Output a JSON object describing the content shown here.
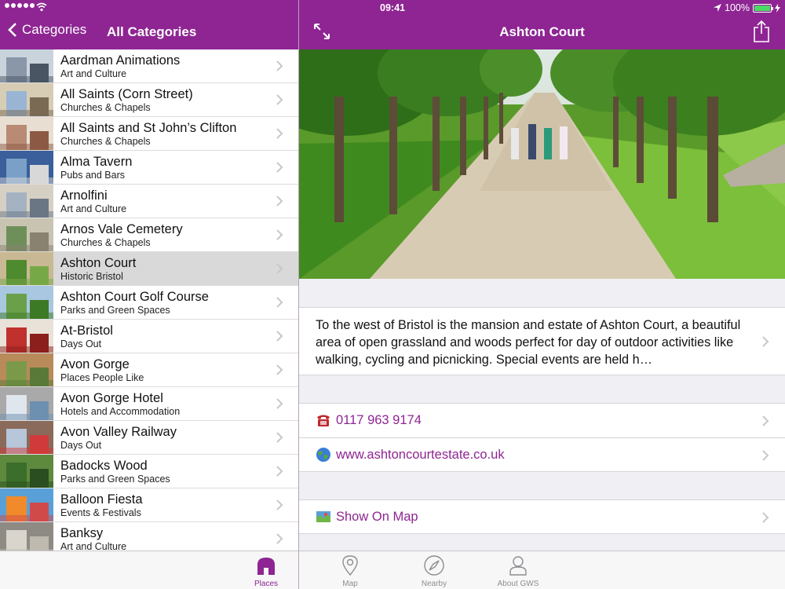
{
  "status": {
    "time": "09:41",
    "battery": "100%",
    "battery_level": 1.0
  },
  "colors": {
    "brand": "#8e2593",
    "selected_row": "#d9d9d9",
    "link": "#8e2593"
  },
  "left_nav": {
    "back_label": "Categories",
    "title": "All Categories"
  },
  "right_nav": {
    "title": "Ashton Court"
  },
  "places": [
    {
      "title": "Aardman Animations",
      "category": "Art and Culture"
    },
    {
      "title": "All Saints (Corn Street)",
      "category": "Churches & Chapels"
    },
    {
      "title": "All Saints and St John’s Clifton",
      "category": "Churches & Chapels"
    },
    {
      "title": "Alma Tavern",
      "category": "Pubs and Bars"
    },
    {
      "title": "Arnolfini",
      "category": "Art and Culture"
    },
    {
      "title": "Arnos Vale Cemetery",
      "category": "Churches & Chapels"
    },
    {
      "title": "Ashton Court",
      "category": "Historic Bristol",
      "selected": true
    },
    {
      "title": "Ashton Court Golf Course",
      "category": "Parks and Green Spaces"
    },
    {
      "title": "At-Bristol",
      "category": "Days Out"
    },
    {
      "title": "Avon Gorge",
      "category": "Places People Like"
    },
    {
      "title": "Avon Gorge Hotel",
      "category": "Hotels and Accommodation"
    },
    {
      "title": "Avon Valley Railway",
      "category": "Days Out"
    },
    {
      "title": "Badocks Wood",
      "category": "Parks and Green Spaces"
    },
    {
      "title": "Balloon Fiesta",
      "category": "Events & Festivals"
    },
    {
      "title": "Banksy",
      "category": "Art and Culture"
    }
  ],
  "detail": {
    "description": "To the west of Bristol is the mansion and estate of Ashton Court, a beautiful area of open grassland and woods perfect for day of outdoor activities like walking, cycling and picnicking. Special events are held h…",
    "phone": "0117 963 9174",
    "website": "www.ashtoncourtestate.co.uk",
    "map_label": "Show On Map",
    "phone_icon": "telephone-icon",
    "web_icon": "globe-icon",
    "map_icon": "map-icon"
  },
  "tabs": [
    {
      "label": "Places",
      "icon": "building-icon",
      "active": true
    },
    {
      "label": "Map",
      "icon": "map-pin-icon"
    },
    {
      "label": "Nearby",
      "icon": "compass-icon"
    },
    {
      "label": "About GWS",
      "icon": "person-icon"
    }
  ]
}
